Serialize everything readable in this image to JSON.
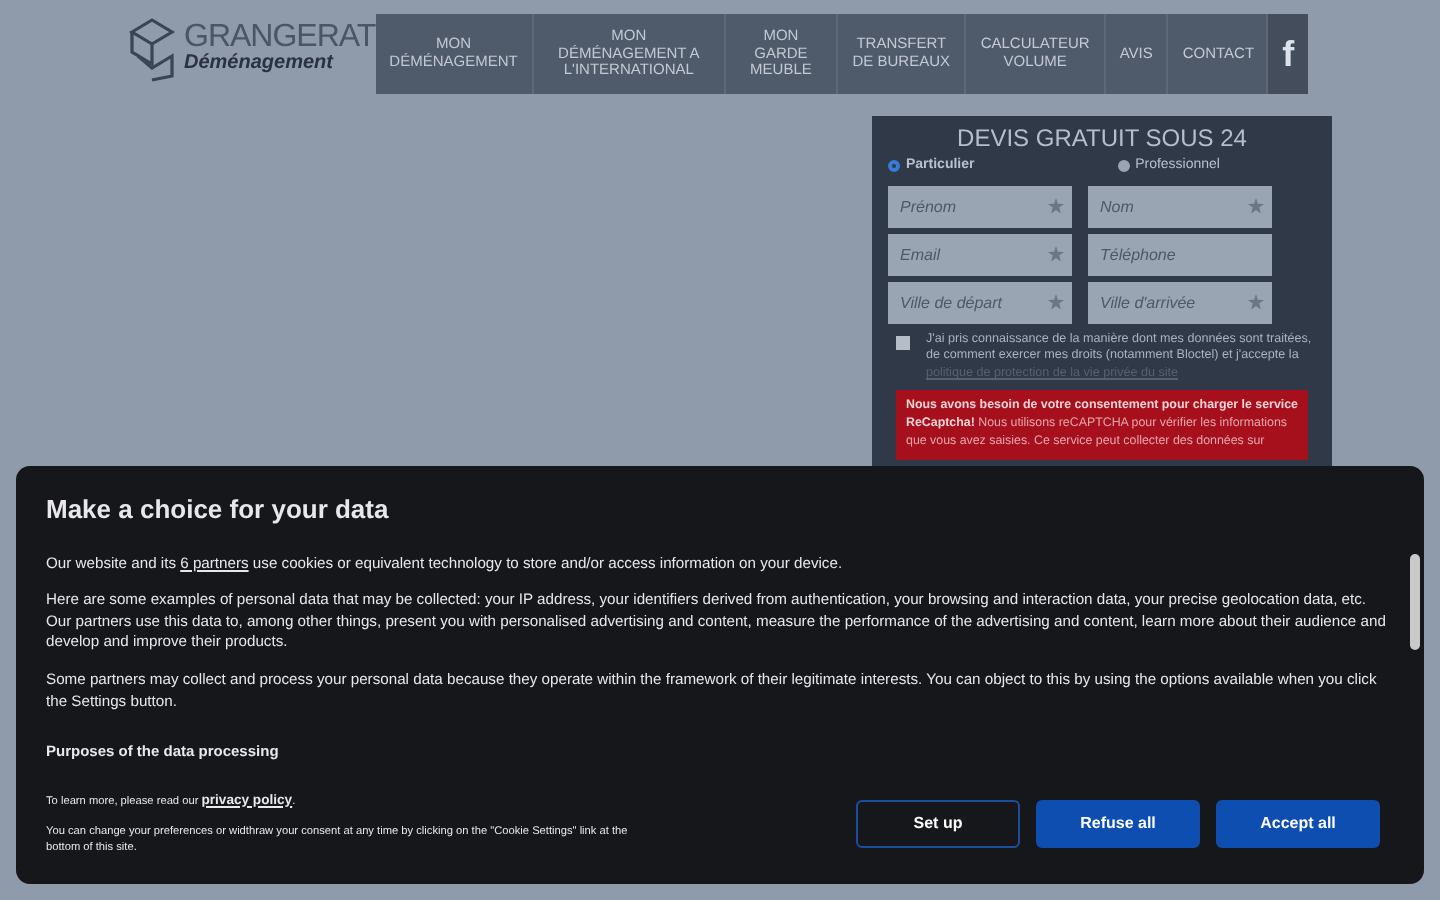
{
  "header": {
    "logo_name": "GRANGERAT",
    "logo_tagline": "Déménagement",
    "nav": [
      {
        "label": "MON DÉMÉNAGEMENT"
      },
      {
        "label": "MON DÉMÉNAGEMENT A L'INTERNATIONAL"
      },
      {
        "label": "MON GARDE MEUBLE"
      },
      {
        "label": "TRANSFERT DE BUREAUX"
      },
      {
        "label": "CALCULATEUR VOLUME"
      },
      {
        "label": "AVIS"
      },
      {
        "label": "CONTACT"
      }
    ],
    "social": "f"
  },
  "quote_form": {
    "title": "DEVIS GRATUIT SOUS 24",
    "client_types": [
      {
        "label": "Particulier",
        "selected": true
      },
      {
        "label": "Professionnel",
        "selected": false
      }
    ],
    "fields": [
      {
        "placeholder": "Prénom",
        "required": true
      },
      {
        "placeholder": "Nom",
        "required": true
      },
      {
        "placeholder": "Email",
        "required": true
      },
      {
        "placeholder": "Téléphone",
        "required": false
      },
      {
        "placeholder": "Ville de départ",
        "required": true
      },
      {
        "placeholder": "Ville d'arrivée",
        "required": true
      }
    ],
    "consent": {
      "checked": false,
      "text": "J'ai pris connaissance de la manière dont mes données sont traitées, de comment exercer mes droits (notamment Bloctel) et j'accepte la",
      "link": "politique de protection de la vie privée du site"
    },
    "recaptcha_notice": "**Nous avons besoin de votre consentement pour charger le service ReCaptcha!** Nous utilisons reCAPTCHA pour vérifier les informations que vous avez saisies. Ce service peut collecter des données sur"
  },
  "cookie_dialog": {
    "title": "Make a choice for your data",
    "intro_before": "Our website and its",
    "partners_link": "6 partners",
    "intro_after": "use cookies or equivalent technology to store and/or access information on your device.",
    "paragraphs": [
      "Here are some examples of personal data that may be collected: your IP address, your identifiers derived from authentication, your browsing and interaction data, your precise geolocation data, etc.\nOur partners use this data to, among other things, present you with personalised advertising and content, measure the performance of the advertising and content, learn more about their audience and develop and improve their products.",
      "Some partners may collect and process your personal data because they operate within the framework of their legitimate interests. You can object to this by using the options available when you click the Settings button."
    ],
    "purposes_heading": "Purposes of the data processing",
    "privacy_before": "To learn more, please read our",
    "privacy_link": "privacy policy",
    "privacy_after": ".",
    "change_note": "You can change your preferences or widthraw your consent at any time by clicking on the \"Cookie Settings\" link at the bottom of this site.",
    "buttons": [
      {
        "label": "Set up",
        "kind": "outline"
      },
      {
        "label": "Refuse all",
        "kind": "solid"
      },
      {
        "label": "Accept all",
        "kind": "solid"
      }
    ]
  }
}
